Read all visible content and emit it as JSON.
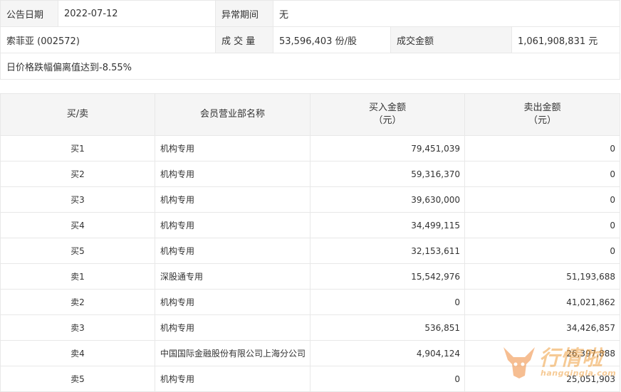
{
  "info": {
    "announce_date_label": "公告日期",
    "announce_date": "2022-07-12",
    "abnormal_period_label": "异常期间",
    "abnormal_period": "无",
    "stock": "索菲亚 (002572)",
    "volume_label": "成 交 量",
    "volume": "53,596,403 份/股",
    "amount_label": "成交金额",
    "amount": "1,061,908,831 元",
    "reason": "日价格跌幅偏离值达到-8.55%"
  },
  "table": {
    "headers": {
      "side": "买/卖",
      "dept": "会员营业部名称",
      "buy_line1": "买入金额",
      "buy_line2": "（元）",
      "sell_line1": "卖出金额",
      "sell_line2": "（元）"
    },
    "rows": [
      {
        "side": "买1",
        "dept": "机构专用",
        "buy": "79,451,039",
        "sell": "0"
      },
      {
        "side": "买2",
        "dept": "机构专用",
        "buy": "59,316,370",
        "sell": "0"
      },
      {
        "side": "买3",
        "dept": "机构专用",
        "buy": "39,630,000",
        "sell": "0"
      },
      {
        "side": "买4",
        "dept": "机构专用",
        "buy": "34,499,115",
        "sell": "0"
      },
      {
        "side": "买5",
        "dept": "机构专用",
        "buy": "32,153,611",
        "sell": "0"
      },
      {
        "side": "卖1",
        "dept": "深股通专用",
        "buy": "15,542,976",
        "sell": "51,193,688"
      },
      {
        "side": "卖2",
        "dept": "机构专用",
        "buy": "0",
        "sell": "41,021,862"
      },
      {
        "side": "卖3",
        "dept": "机构专用",
        "buy": "536,851",
        "sell": "34,426,857"
      },
      {
        "side": "卖4",
        "dept": "中国国际金融股份有限公司上海分公司",
        "buy": "4,904,124",
        "sell": "26,397,888"
      },
      {
        "side": "卖5",
        "dept": "机构专用",
        "buy": "0",
        "sell": "25,051,903"
      }
    ]
  },
  "watermark": {
    "brand": "行情啦",
    "url": "hangqingla.com"
  }
}
